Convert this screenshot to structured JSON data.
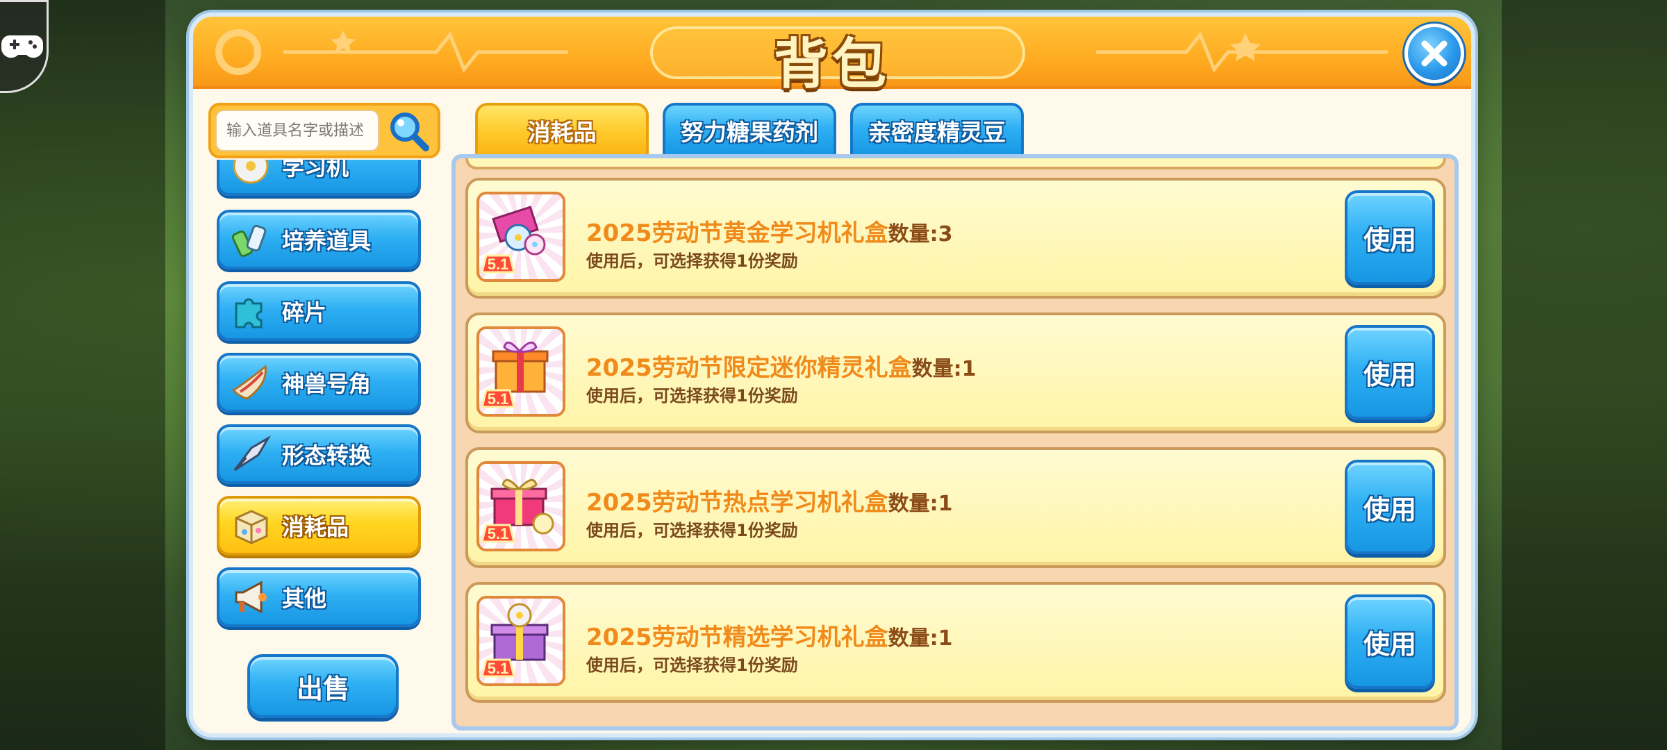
{
  "window": {
    "title": "背包",
    "close_icon": "close-icon"
  },
  "search": {
    "placeholder": "输入道具名字或描述",
    "icon": "search-icon"
  },
  "sidebar": {
    "items": [
      {
        "label": "学习机",
        "icon": "disc-icon",
        "active": false
      },
      {
        "label": "培养道具",
        "icon": "potion-icon",
        "active": false
      },
      {
        "label": "碎片",
        "icon": "puzzle-icon",
        "active": false
      },
      {
        "label": "神兽号角",
        "icon": "horn-icon",
        "active": false
      },
      {
        "label": "形态转换",
        "icon": "blade-icon",
        "active": false
      },
      {
        "label": "消耗品",
        "icon": "box-icon",
        "active": true
      },
      {
        "label": "其他",
        "icon": "megaphone-icon",
        "active": false
      }
    ],
    "sell_label": "出售"
  },
  "tabs": [
    {
      "label": "消耗品",
      "active": true
    },
    {
      "label": "努力糖果药剂",
      "active": false
    },
    {
      "label": "亲密度精灵豆",
      "active": false
    }
  ],
  "items": [
    {
      "name": "2025劳动节黄金学习机礼盒",
      "qty_label": "数量:",
      "qty": "3",
      "desc": "使用后，可选择获得1份奖励",
      "use_label": "使用",
      "icon": "gold-gift-box-icon",
      "badge": "5.1"
    },
    {
      "name": "2025劳动节限定迷你精灵礼盒",
      "qty_label": "数量:",
      "qty": "1",
      "desc": "使用后，可选择获得1份奖励",
      "use_label": "使用",
      "icon": "mini-spirit-gift-box-icon",
      "badge": "5.1"
    },
    {
      "name": "2025劳动节热点学习机礼盒",
      "qty_label": "数量:",
      "qty": "1",
      "desc": "使用后，可选择获得1份奖励",
      "use_label": "使用",
      "icon": "hot-gift-box-icon",
      "badge": "5.1"
    },
    {
      "name": "2025劳动节精选学习机礼盒",
      "qty_label": "数量:",
      "qty": "1",
      "desc": "使用后，可选择获得1份奖励",
      "use_label": "使用",
      "icon": "selected-gift-box-icon",
      "badge": "5.1"
    }
  ],
  "colors": {
    "header": "#ffac22",
    "button_blue": "#2fb0f3",
    "active_yellow": "#ffd61f",
    "item_name": "#f08a1a",
    "row_bg": "#fff4a6"
  }
}
